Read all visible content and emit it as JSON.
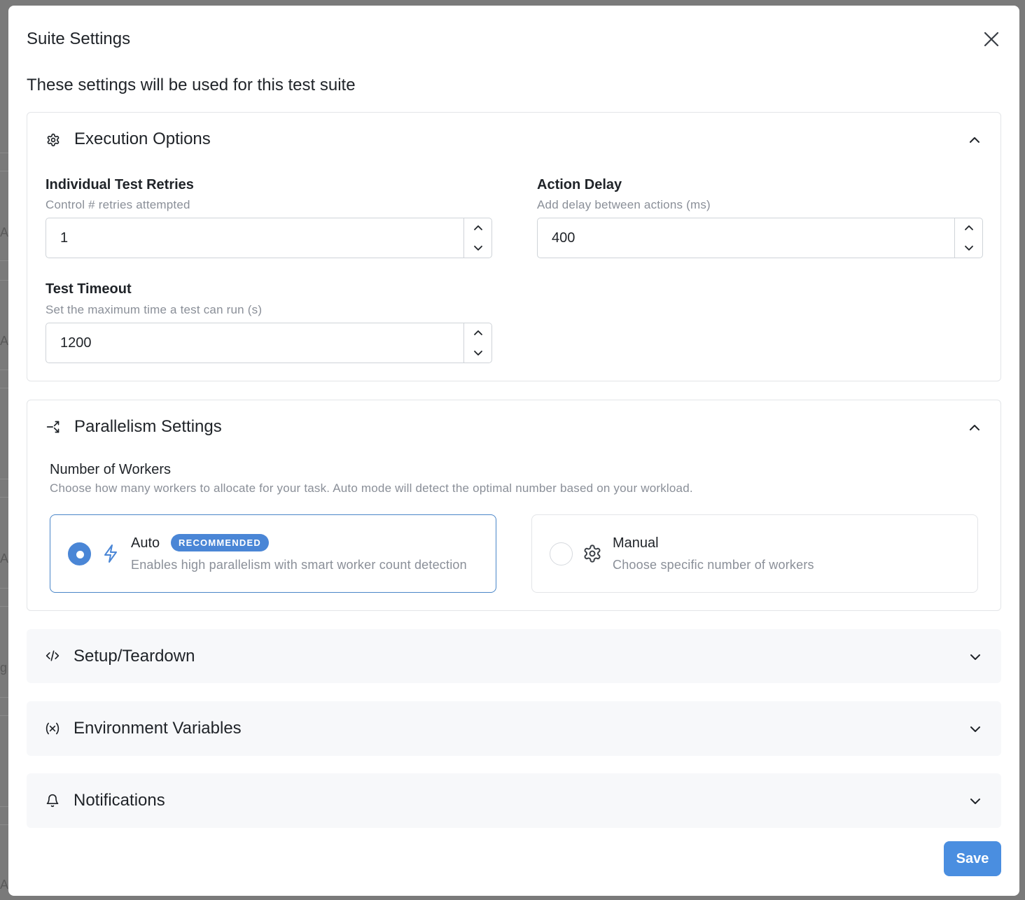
{
  "dialog": {
    "title": "Suite Settings",
    "subtitle": "These settings will be used for this test suite",
    "save_label": "Save"
  },
  "execution": {
    "title": "Execution Options",
    "expanded": true,
    "retries": {
      "label": "Individual Test Retries",
      "help": "Control # retries attempted",
      "value": "1"
    },
    "delay": {
      "label": "Action Delay",
      "help": "Add delay between actions (ms)",
      "value": "400"
    },
    "timeout": {
      "label": "Test Timeout",
      "help": "Set the maximum time a test can run (s)",
      "value": "1200"
    }
  },
  "parallelism": {
    "title": "Parallelism Settings",
    "expanded": true,
    "workers_label": "Number of Workers",
    "workers_help": "Choose how many workers to allocate for your task. Auto mode will detect the optimal number based on your workload.",
    "options": [
      {
        "title": "Auto",
        "badge": "RECOMMENDED",
        "desc": "Enables high parallelism with smart worker count detection",
        "selected": true,
        "icon": "lightning-icon"
      },
      {
        "title": "Manual",
        "desc": "Choose specific number of workers",
        "selected": false,
        "icon": "gear-icon"
      }
    ]
  },
  "collapsed_sections": [
    {
      "title": "Setup/Teardown",
      "icon": "code-icon"
    },
    {
      "title": "Environment Variables",
      "icon": "variable-icon"
    },
    {
      "title": "Notifications",
      "icon": "bell-icon"
    }
  ],
  "colors": {
    "accent": "#4a86d6",
    "save": "#4a8ee0",
    "muted_text": "#8a8f98",
    "border": "#e3e5e8"
  },
  "background_letters": [
    "A",
    "A",
    "A",
    "g",
    "A"
  ]
}
